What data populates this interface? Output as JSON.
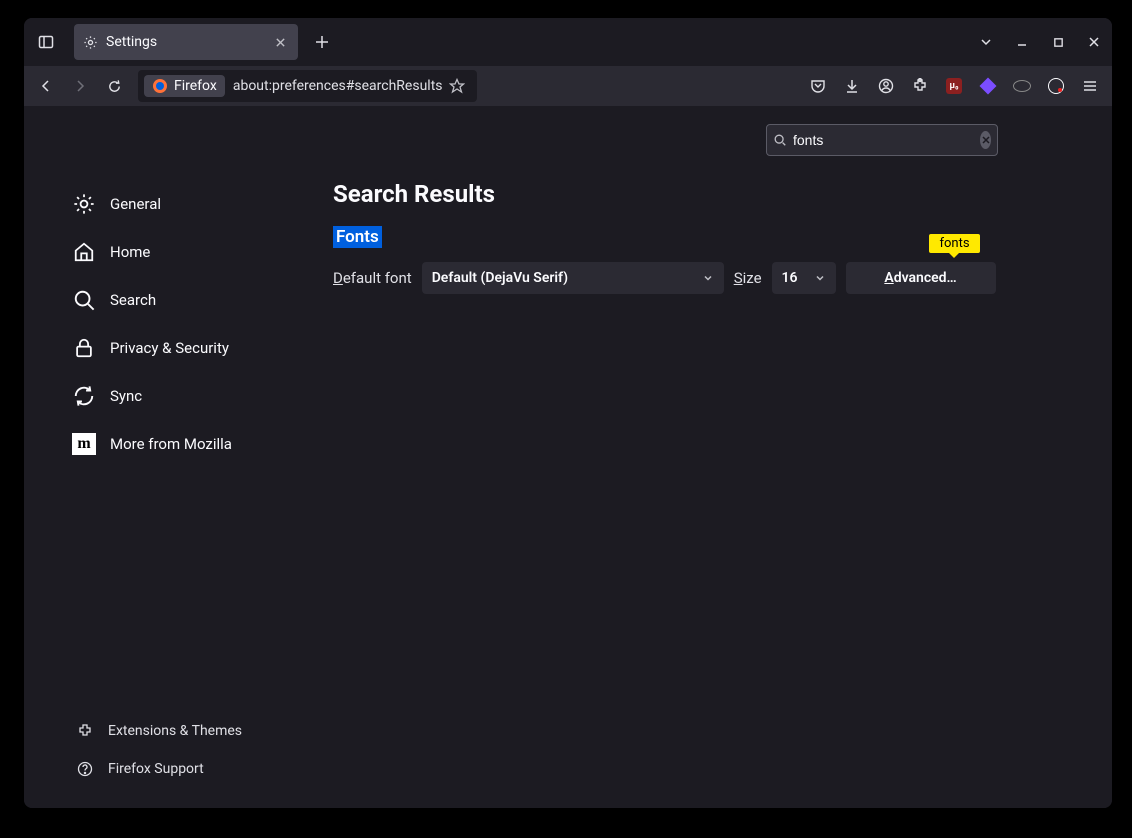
{
  "tab": {
    "title": "Settings"
  },
  "urlbar": {
    "identity": "Firefox",
    "url": "about:preferences#searchResults"
  },
  "settings_search": {
    "value": "fonts"
  },
  "categories": {
    "general": "General",
    "home": "Home",
    "search": "Search",
    "privacy": "Privacy & Security",
    "sync": "Sync",
    "more": "More from Mozilla"
  },
  "bottom": {
    "extensions": "Extensions & Themes",
    "support": "Firefox Support"
  },
  "main": {
    "page_title": "Search Results",
    "section_title": "Fonts",
    "default_font_label": "Default font",
    "default_font_value": "Default (DejaVu Serif)",
    "size_label": "Size",
    "size_value": "16",
    "advanced_label": "Advanced…",
    "tooltip": "fonts"
  }
}
